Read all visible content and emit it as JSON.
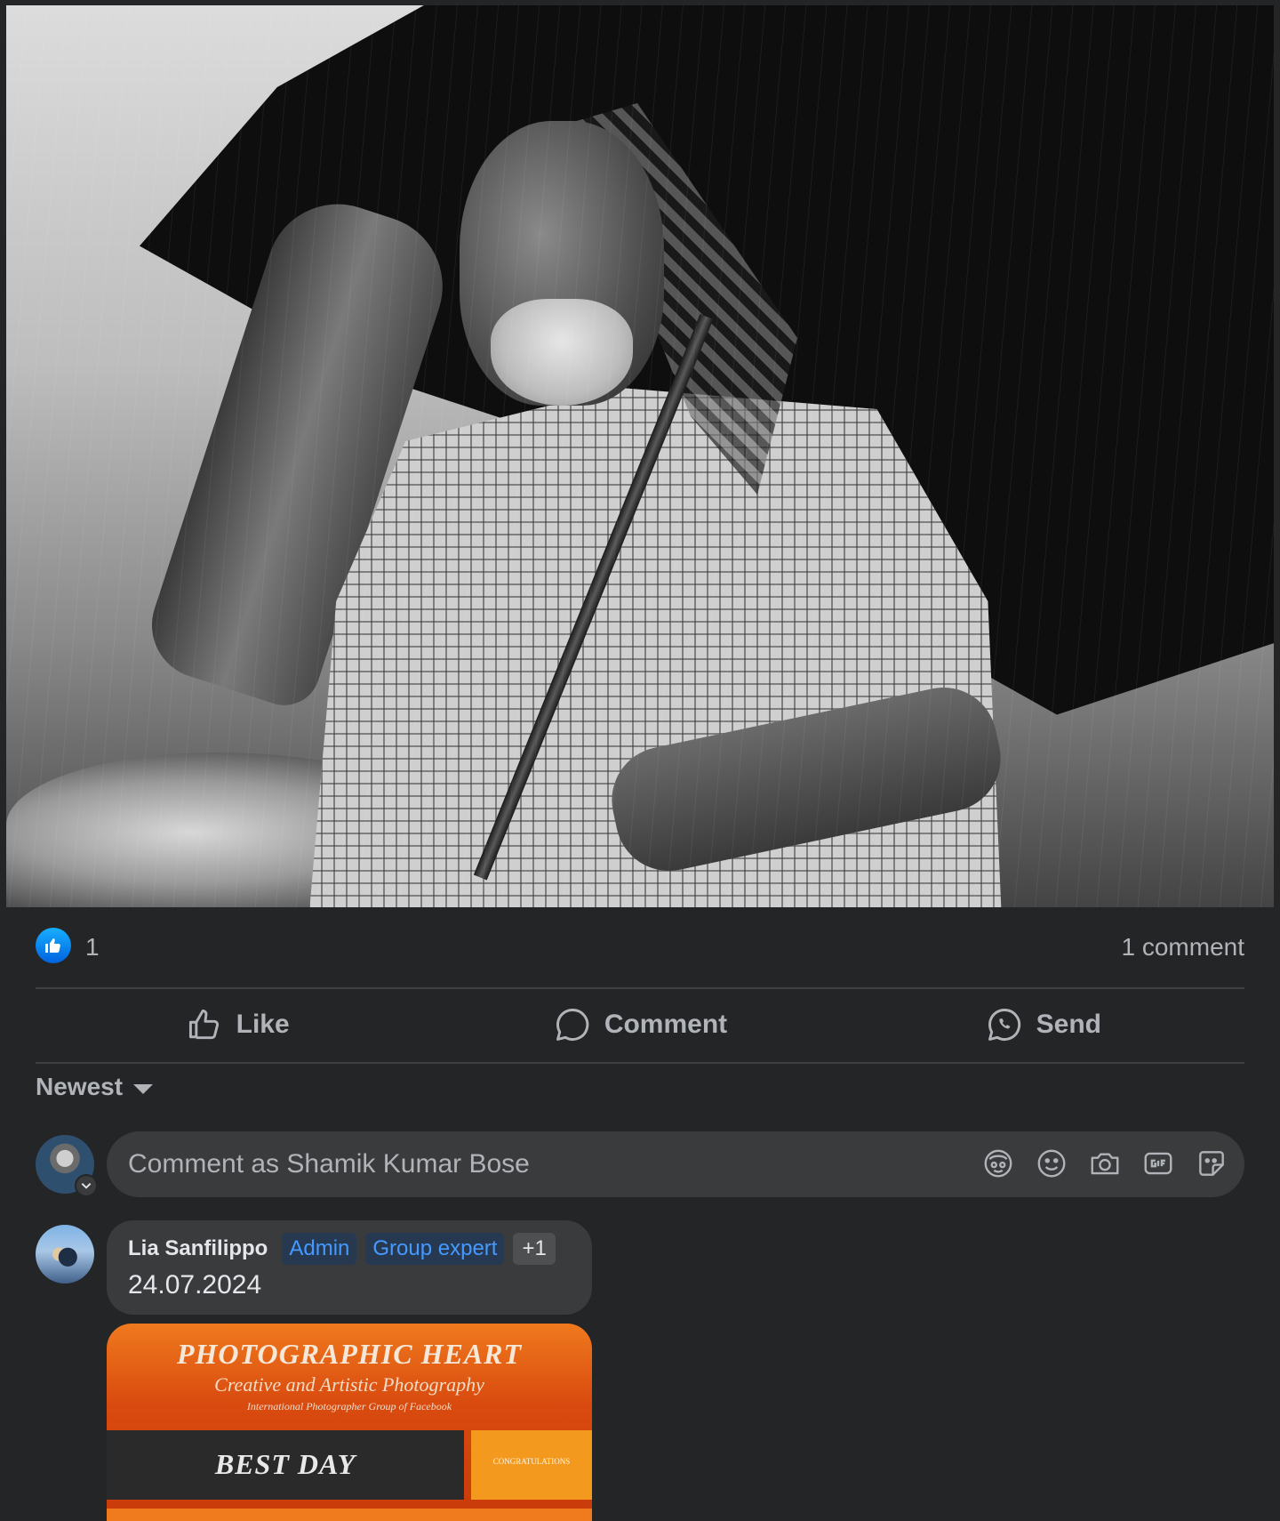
{
  "post": {
    "photo_alt": "Black and white photo of an elderly man holding an umbrella in the rain",
    "reactions": {
      "like_count": "1",
      "comment_count": "1 comment"
    },
    "actions": {
      "like": "Like",
      "comment": "Comment",
      "send": "Send"
    },
    "sort": {
      "label": "Newest"
    },
    "composer": {
      "placeholder": "Comment as Shamik Kumar Bose"
    }
  },
  "comments": [
    {
      "author": "Lia Sanfilippo",
      "badges": [
        "Admin",
        "Group expert"
      ],
      "more_badges": "+1",
      "text": "24.07.2024",
      "image": {
        "title": "PHOTOGRAPHIC HEART",
        "subtitle": "Creative and Artistic Photography",
        "tagline": "International Photographer Group of Facebook",
        "band_label": "BEST DAY",
        "tag_label": "CONGRATULATIONS"
      }
    }
  ],
  "colors": {
    "background": "#242526",
    "bubble": "#3a3b3c",
    "text_primary": "#e4e6eb",
    "text_secondary": "#b0b3b8",
    "like_blue": "#0062df",
    "badge_blue": "#4599ff"
  },
  "icons": {
    "reaction": "like-thumb-icon",
    "like": "thumbs-up-icon",
    "comment": "speech-bubble-icon",
    "send": "whatsapp-icon",
    "composer": [
      "avatar-sticker-icon",
      "emoji-icon",
      "camera-icon",
      "gif-icon",
      "sticker-icon"
    ]
  }
}
